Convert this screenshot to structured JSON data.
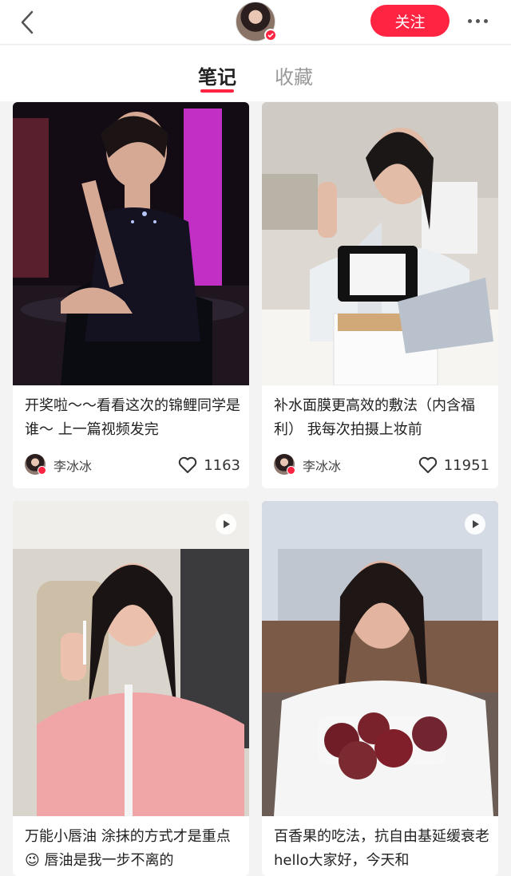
{
  "header": {
    "follow_label": "关注",
    "icons": {
      "back": "chevron-left-icon",
      "more": "more-dots-icon",
      "verified": "verified-badge-icon"
    },
    "colors": {
      "accent": "#ff2442"
    }
  },
  "tabs": [
    {
      "label": "笔记",
      "active": true
    },
    {
      "label": "收藏",
      "active": false
    }
  ],
  "feed": [
    {
      "title": "开奖啦～～看看这次的锦鲤同学是谁～ 上一篇视频发完",
      "author": "李冰冰",
      "likes": "1163"
    },
    {
      "title": "补水面膜更高效的敷法（内含福利） 我每次拍摄上妆前",
      "author": "李冰冰",
      "likes": "11951"
    },
    {
      "title": "万能小唇油 涂抹的方式才是重点😉 唇油是我一步不离的",
      "author": "",
      "likes": ""
    },
    {
      "title": "百香果的吃法，抗自由基延缓衰老 hello大家好，今天和",
      "author": "",
      "likes": ""
    }
  ]
}
